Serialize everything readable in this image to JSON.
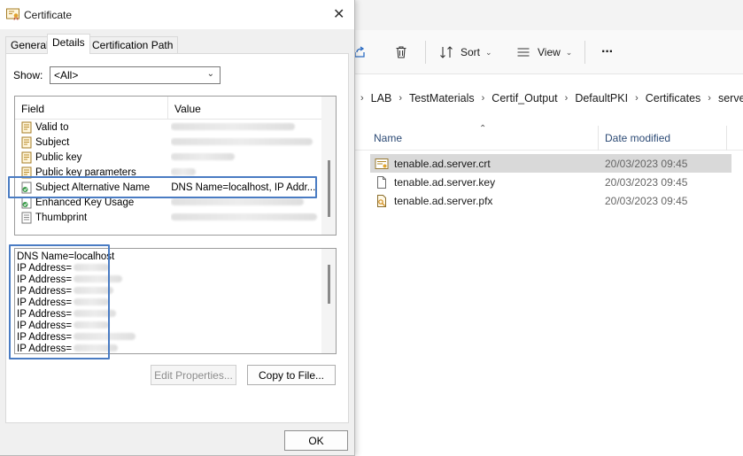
{
  "explorer": {
    "toolbar": {
      "sort_label": "Sort",
      "view_label": "View",
      "more_label": "···"
    },
    "breadcrumbs": [
      "LAB",
      "TestMaterials",
      "Certif_Output",
      "DefaultPKI",
      "Certificates",
      "server"
    ],
    "columns": {
      "name": "Name",
      "date": "Date modified"
    },
    "files": [
      {
        "name": "tenable.ad.server.crt",
        "date": "20/03/2023 09:45",
        "icon": "certificate-file-icon",
        "selected": true
      },
      {
        "name": "tenable.ad.server.key",
        "date": "20/03/2023 09:45",
        "icon": "blank-file-icon",
        "selected": false
      },
      {
        "name": "tenable.ad.server.pfx",
        "date": "20/03/2023 09:45",
        "icon": "pfx-file-icon",
        "selected": false
      }
    ]
  },
  "dialog": {
    "title": "Certificate",
    "tabs": [
      "General",
      "Details",
      "Certification Path"
    ],
    "active_tab": "Details",
    "show_label": "Show:",
    "show_value": "<All>",
    "fields_header": {
      "field": "Field",
      "value": "Value"
    },
    "fields": [
      {
        "name": "Valid to",
        "value": ""
      },
      {
        "name": "Subject",
        "value": ""
      },
      {
        "name": "Public key",
        "value": ""
      },
      {
        "name": "Public key parameters",
        "value": ""
      },
      {
        "name": "Subject Alternative Name",
        "value": "DNS Name=localhost, IP Addr..."
      },
      {
        "name": "Enhanced Key Usage",
        "value": ""
      },
      {
        "name": "Thumbprint",
        "value": ""
      }
    ],
    "detail_lines": [
      "DNS Name=localhost",
      "IP Address=",
      "IP Address=",
      "IP Address=",
      "IP Address=",
      "IP Address=",
      "IP Address=",
      "IP Address=",
      "IP Address="
    ],
    "edit_properties_label": "Edit Properties...",
    "copy_to_file_label": "Copy to File...",
    "ok_label": "OK"
  },
  "colors": {
    "highlight": "#4a7cc3",
    "selected_row": "#d9d9d9"
  }
}
